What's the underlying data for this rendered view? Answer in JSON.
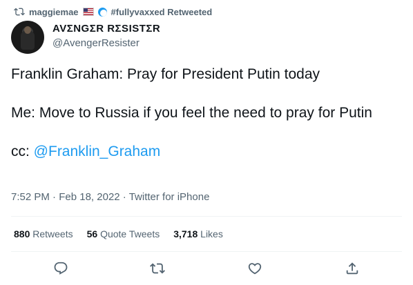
{
  "retweet_header": {
    "user": "maggiemae",
    "suffix": "#fullyvaxxed Retweeted"
  },
  "author": {
    "display_name": "AVΣNGΣR RΣSISTΣR",
    "handle": "@AvengerResister"
  },
  "tweet": {
    "line1": "Franklin Graham: Pray for President Putin today",
    "line2": "Me: Move to Russia if you feel the need to pray for Putin",
    "cc_prefix": "cc: ",
    "mention": "@Franklin_Graham"
  },
  "meta": {
    "time": "7:52 PM",
    "date": "Feb 18, 2022",
    "source": "Twitter for iPhone",
    "sep": " · "
  },
  "stats": {
    "retweets_count": "880",
    "retweets_label": "Retweets",
    "quotes_count": "56",
    "quotes_label": "Quote Tweets",
    "likes_count": "3,718",
    "likes_label": "Likes"
  },
  "colors": {
    "accent": "#1d9bf0",
    "muted": "#536471",
    "text": "#0f1419"
  },
  "icons": [
    "retweet-icon",
    "us-flag-icon",
    "wave-icon",
    "reply-icon",
    "retweet-icon",
    "like-icon",
    "share-icon"
  ]
}
